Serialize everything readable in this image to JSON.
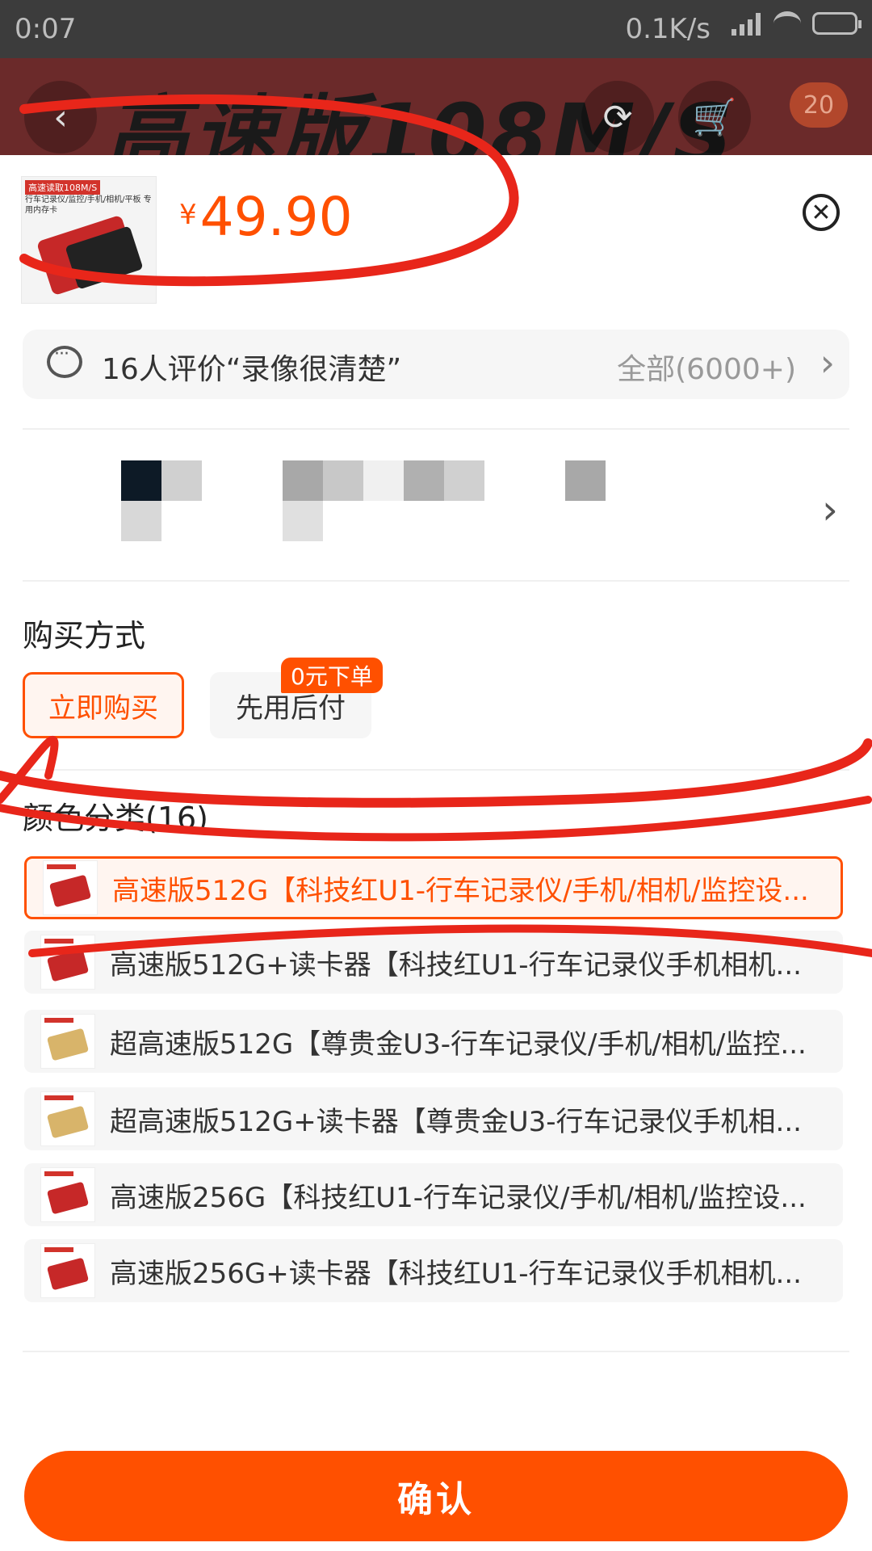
{
  "status_bar": {
    "time": "0:07",
    "net_speed": "0.1K/s"
  },
  "header": {
    "banner": "高速版108M/S",
    "cart_count": "20"
  },
  "product": {
    "thumb_tag": "高速读取108M/S",
    "thumb_sub": "行车记录仪/监控/手机/相机/平板 专用内存卡",
    "currency": "¥",
    "price": "49.90"
  },
  "review": {
    "text": "16人评价“录像很清楚”",
    "all_label": "全部(6000+)"
  },
  "purchase": {
    "title": "购买方式",
    "options": [
      {
        "label": "立即购买",
        "selected": true
      },
      {
        "label": "先用后付",
        "selected": false,
        "badge": "0元下单"
      }
    ]
  },
  "color": {
    "title": "颜色分类(16)",
    "items": [
      {
        "label": "高速版512G【科技红U1-行车记录仪/手机/相机/监控设...",
        "selected": true,
        "card_color": "#c62828"
      },
      {
        "label": "高速版512G+读卡器【科技红U1-行车记录仪手机相机...",
        "selected": false,
        "card_color": "#c62828"
      },
      {
        "label": "超高速版512G【尊贵金U3-行车记录仪/手机/相机/监控...",
        "selected": false,
        "card_color": "#d8b46a"
      },
      {
        "label": "超高速版512G+读卡器【尊贵金U3-行车记录仪手机相...",
        "selected": false,
        "card_color": "#d8b46a"
      },
      {
        "label": "高速版256G【科技红U1-行车记录仪/手机/相机/监控设...",
        "selected": false,
        "card_color": "#c62828"
      },
      {
        "label": "高速版256G+读卡器【科技红U1-行车记录仪手机相机...",
        "selected": false,
        "card_color": "#c62828"
      }
    ]
  },
  "confirm_label": "确认",
  "colors": {
    "accent": "#ff5000",
    "annotation": "#e8261a"
  },
  "icons": [
    "back-arrow-icon",
    "share-icon",
    "cart-icon",
    "close-icon",
    "comment-icon",
    "chevron-right-icon"
  ]
}
